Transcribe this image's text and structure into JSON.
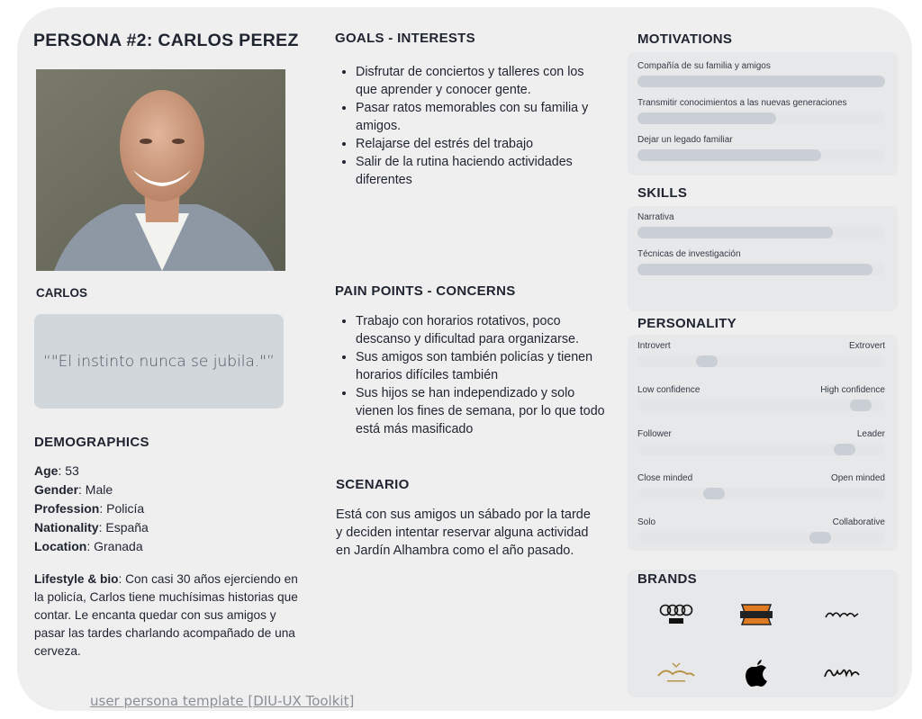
{
  "persona": {
    "title": "PERSONA #2:  CARLOS PEREZ",
    "name": "CARLOS",
    "quote": "“\"El instinto nunca se jubila.\"”"
  },
  "demographics": {
    "heading": "DEMOGRAPHICS",
    "age_label": "Age",
    "age": "53",
    "gender_label": "Gender",
    "gender": "Male",
    "profession_label": "Profession",
    "profession": "Policía",
    "nationality_label": "Nationality",
    "nationality": "España",
    "location_label": "Location",
    "location": "Granada",
    "bio_label": "Lifestyle & bio",
    "bio": "Con casi 30 años ejerciendo en la policía, Carlos tiene muchísimas historias que contar. Le encanta quedar con sus amigos y pasar las tardes charlando acompañado de una cerveza."
  },
  "goals": {
    "heading": "GOALS - INTERESTS",
    "items": [
      "Disfrutar de conciertos y talleres con los que aprender y conocer gente.",
      "Pasar ratos memorables con su familia y amigos.",
      "Relajarse del estrés del trabajo",
      "Salir de la rutina haciendo actividades diferentes"
    ]
  },
  "pains": {
    "heading": "PAIN POINTS - CONCERNS",
    "items": [
      "Trabajo con horarios rotativos, poco descanso y dificultad para organizarse.",
      "Sus amigos son también policías y tienen horarios difíciles también",
      "Sus hijos se han independizado y solo vienen los fines de semana, por lo que todo está más masificado"
    ]
  },
  "scenario": {
    "heading": "SCENARIO",
    "text": "Está con sus amigos un sábado por la tarde y deciden intentar reservar alguna actividad en Jardín Alhambra como el año pasado."
  },
  "motivations": {
    "heading": "MOTIVATIONS",
    "items": [
      {
        "label": "Compañía de su familia y amigos",
        "level": 1.0
      },
      {
        "label": "Transmitir conocimientos a las nuevas generaciones",
        "level": 0.56
      },
      {
        "label": "Dejar un legado familiar",
        "level": 0.74
      }
    ]
  },
  "skills": {
    "heading": "SKILLS",
    "items": [
      {
        "label": "Narrativa",
        "level": 0.79
      },
      {
        "label": "Técnicas de investigación",
        "level": 0.95
      }
    ]
  },
  "personality": {
    "heading": "PERSONALITY",
    "items": [
      {
        "left": "Introvert",
        "right": "Extrovert",
        "level": 0.26
      },
      {
        "left": "Low confidence",
        "right": "High confidence",
        "level": 0.94
      },
      {
        "left": "Follower",
        "right": "Leader",
        "level": 0.87
      },
      {
        "left": "Close minded",
        "right": "Open minded",
        "level": 0.29
      },
      {
        "left": "Solo",
        "right": "Collaborative",
        "level": 0.76
      }
    ]
  },
  "brands": {
    "heading": "BRANDS",
    "items": [
      {
        "name": "Audi",
        "icon": "audi-logo"
      },
      {
        "name": "Harley-Davidson",
        "icon": "harley-davidson-logo"
      },
      {
        "name": "Jack Daniel's",
        "icon": "jack-daniels-logo"
      },
      {
        "name": "Alhambra",
        "icon": "alhambra-logo"
      },
      {
        "name": "Apple",
        "icon": "apple-logo"
      },
      {
        "name": "Ray-Ban",
        "icon": "ray-ban-logo"
      }
    ]
  },
  "footer": {
    "link": "user persona template [DIU-UX Toolkit]"
  },
  "colors": {
    "card": "#efefef",
    "panel": "#e7e8ea",
    "quote_box": "#d2d7dc",
    "bar_fill": "#c9cfd4",
    "bar_track": "#e3e5e7"
  }
}
